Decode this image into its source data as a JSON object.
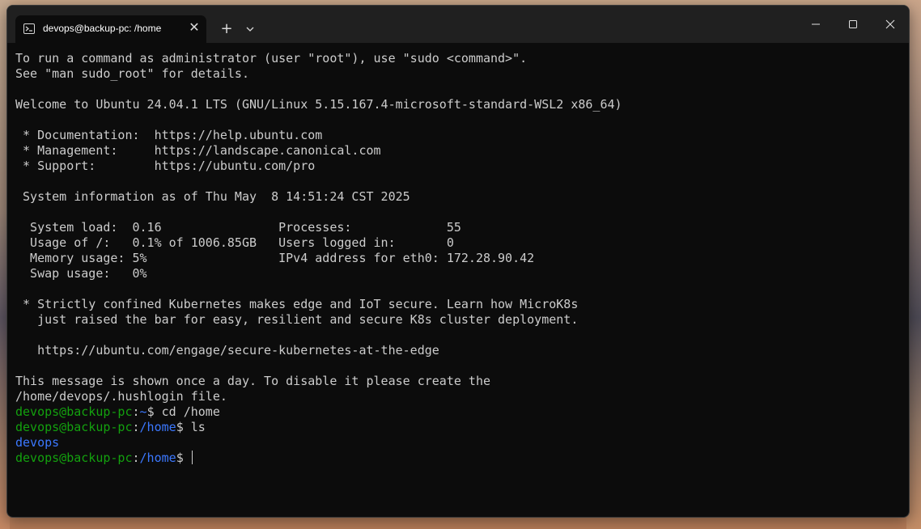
{
  "window": {
    "tab_title": "devops@backup-pc: /home",
    "tab_icon": "terminal-icon",
    "close_tab_symbol": "✕",
    "new_tab_symbol": "+",
    "controls": {
      "minimize_icon": "minimize-icon",
      "maximize_icon": "maximize-icon",
      "close_icon": "close-icon"
    }
  },
  "terminal": {
    "lines": [
      "To run a command as administrator (user \"root\"), use \"sudo <command>\".",
      "See \"man sudo_root\" for details.",
      "",
      "Welcome to Ubuntu 24.04.1 LTS (GNU/Linux 5.15.167.4-microsoft-standard-WSL2 x86_64)",
      "",
      " * Documentation:  https://help.ubuntu.com",
      " * Management:     https://landscape.canonical.com",
      " * Support:        https://ubuntu.com/pro",
      "",
      " System information as of Thu May  8 14:51:24 CST 2025",
      "",
      "  System load:  0.16                Processes:             55",
      "  Usage of /:   0.1% of 1006.85GB   Users logged in:       0",
      "  Memory usage: 5%                  IPv4 address for eth0: 172.28.90.42",
      "  Swap usage:   0%",
      "",
      " * Strictly confined Kubernetes makes edge and IoT secure. Learn how MicroK8s",
      "   just raised the bar for easy, resilient and secure K8s cluster deployment.",
      "",
      "   https://ubuntu.com/engage/secure-kubernetes-at-the-edge",
      "",
      "This message is shown once a day. To disable it please create the",
      "/home/devops/.hushlogin file."
    ],
    "prompt_user": "devops@backup-pc",
    "sep": ":",
    "cmd1": {
      "path": "~",
      "dollar": "$",
      "command": " cd /home"
    },
    "cmd2": {
      "path": "/home",
      "dollar": "$",
      "command": " ls"
    },
    "ls_output": "devops",
    "cmd3": {
      "path": "/home",
      "dollar": "$",
      "command": " "
    }
  },
  "colors": {
    "prompt_user": "#13a10e",
    "prompt_path": "#3b78ff",
    "directory": "#3b78ff",
    "text": "#cccccc",
    "background": "#0c0c0c",
    "titlebar": "#202020"
  }
}
